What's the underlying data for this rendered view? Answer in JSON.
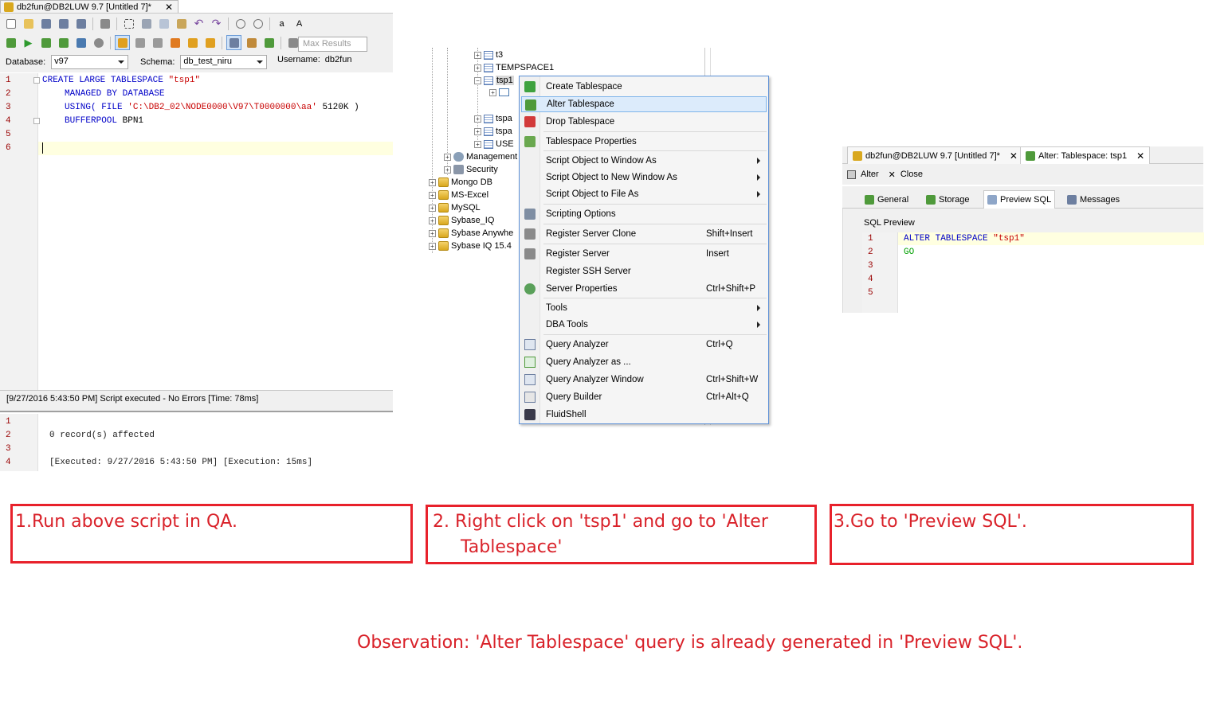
{
  "panel1": {
    "tab_title": "db2fun@DB2LUW 9.7 [Untitled 7]*",
    "max_results_placeholder": "Max Results",
    "database_label": "Database:",
    "database_value": "v97",
    "schema_label": "Schema:",
    "schema_value": "db_test_niru",
    "username_label": "Username:",
    "username_value": "db2fun",
    "editor_line_numbers": [
      "1",
      "2",
      "3",
      "4",
      "5",
      "6"
    ],
    "code": {
      "l1_kw": "CREATE LARGE TABLESPACE ",
      "l1_str": "\"tsp1\"",
      "l2_kw": "MANAGED BY DATABASE",
      "l3_kw": "USING( FILE ",
      "l3_str": "'C:\\DB2_02\\NODE0000\\V97\\T0000000\\aa'",
      "l3_rest": " 5120K )",
      "l4_kw": "BUFFERPOOL ",
      "l4_rest": "BPN1"
    },
    "status": "[9/27/2016 5:43:50 PM] Script executed - No Errors [Time: 78ms]",
    "result_line_numbers": [
      "1",
      "2",
      "3",
      "4"
    ],
    "result_lines": {
      "l2": "0 record(s) affected",
      "l4": "[Executed: 9/27/2016 5:43:50 PM] [Execution: 15ms]"
    }
  },
  "tree": {
    "items": [
      "t3",
      "TEMPSPACE1",
      "tsp1",
      "tspa",
      "tspa",
      "USE",
      "Management",
      "Security",
      "Mongo DB",
      "MS-Excel",
      "MySQL",
      "Sybase_IQ",
      "Sybase Anywhe",
      "Sybase IQ 15.4"
    ]
  },
  "context_menu": {
    "items": [
      {
        "label": "Create Tablespace",
        "shortcut": ""
      },
      {
        "label": "Alter Tablespace",
        "shortcut": ""
      },
      {
        "label": "Drop Tablespace",
        "shortcut": ""
      },
      {
        "label": "Tablespace Properties",
        "shortcut": ""
      },
      {
        "label": "Script Object to Window As",
        "shortcut": ""
      },
      {
        "label": "Script Object to New Window As",
        "shortcut": ""
      },
      {
        "label": "Script Object to File As",
        "shortcut": ""
      },
      {
        "label": "Scripting Options",
        "shortcut": ""
      },
      {
        "label": "Register Server Clone",
        "shortcut": "Shift+Insert"
      },
      {
        "label": "Register Server",
        "shortcut": "Insert"
      },
      {
        "label": "Register SSH Server",
        "shortcut": ""
      },
      {
        "label": "Server Properties",
        "shortcut": "Ctrl+Shift+P"
      },
      {
        "label": "Tools",
        "shortcut": ""
      },
      {
        "label": "DBA Tools",
        "shortcut": ""
      },
      {
        "label": "Query Analyzer",
        "shortcut": "Ctrl+Q"
      },
      {
        "label": "Query Analyzer as ...",
        "shortcut": ""
      },
      {
        "label": "Query Analyzer Window",
        "shortcut": "Ctrl+Shift+W"
      },
      {
        "label": "Query Builder",
        "shortcut": "Ctrl+Alt+Q"
      },
      {
        "label": "FluidShell",
        "shortcut": ""
      }
    ]
  },
  "panel3": {
    "tab1": "db2fun@DB2LUW 9.7 [Untitled 7]*",
    "tab2": "Alter: Tablespace: tsp1",
    "alter_label": "Alter",
    "close_label": "Close",
    "subtabs": [
      "General",
      "Storage",
      "Preview SQL",
      "Messages"
    ],
    "sql_preview_label": "SQL Preview",
    "line_numbers": [
      "1",
      "2",
      "3",
      "4",
      "5"
    ],
    "code_kw": "ALTER TABLESPACE ",
    "code_str": "\"tsp1\"",
    "code_go": "GO"
  },
  "notes": {
    "step1": "1.Run above script in QA.",
    "step2": "2. Right click on 'tsp1' and go to 'Alter\n     Tablespace'",
    "step3": "3.Go to 'Preview SQL'.",
    "observation": "Observation: 'Alter Tablespace' query is already generated in 'Preview SQL'."
  },
  "colors": {
    "note_red": "#e8212b",
    "menu_highlight": "#dcebfb",
    "keyword_blue": "#0000c8",
    "string_red": "#c80000"
  }
}
